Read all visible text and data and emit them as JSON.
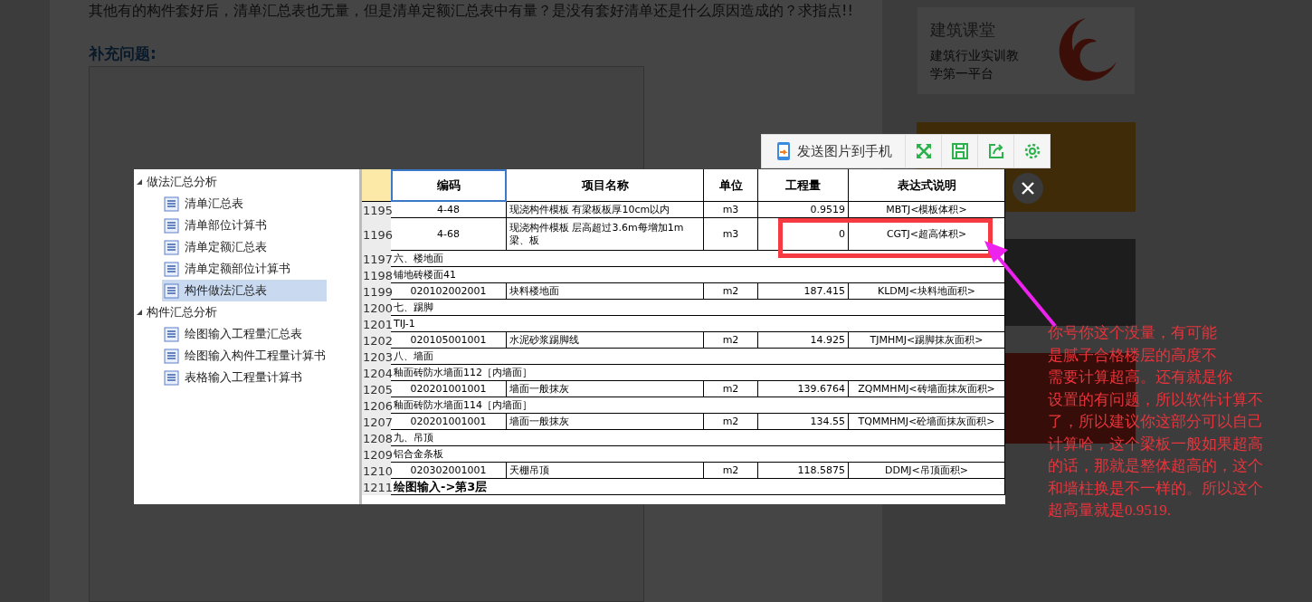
{
  "page": {
    "question": "其他有的构件套好后，清单汇总表也无量，但是清单定额汇总表中有量？是没有套好清单还是什么原因造成的？求指点!!",
    "supplement_heading": "补充问题:"
  },
  "sidebar": {
    "card": {
      "title": "建筑课堂",
      "subtitle": "建筑行业实训教学第一平台"
    }
  },
  "viewer": {
    "toolbar": {
      "send_button": "发送图片到手机"
    },
    "tree": [
      {
        "label": "做法汇总分析",
        "expanded": true,
        "children": [
          {
            "label": "清单汇总表",
            "selected": false
          },
          {
            "label": "清单部位计算书",
            "selected": false
          },
          {
            "label": "清单定额汇总表",
            "selected": false
          },
          {
            "label": "清单定额部位计算书",
            "selected": false
          },
          {
            "label": "构件做法汇总表",
            "selected": true
          }
        ]
      },
      {
        "label": "构件汇总分析",
        "expanded": true,
        "children": [
          {
            "label": "绘图输入工程量汇总表",
            "selected": false
          },
          {
            "label": "绘图输入构件工程量计算书",
            "selected": false
          },
          {
            "label": "表格输入工程量计算书",
            "selected": false
          }
        ]
      }
    ],
    "table": {
      "columns": [
        {
          "label": "编码",
          "selected": true
        },
        {
          "label": "项目名称",
          "selected": false
        },
        {
          "label": "单位",
          "selected": false
        },
        {
          "label": "工程量",
          "selected": false
        },
        {
          "label": "表达式说明",
          "selected": false
        }
      ],
      "rows": [
        {
          "kind": "item",
          "number": "1195",
          "code": "4-48",
          "name": "现浇构件模板 有梁板板厚10cm以内",
          "unit": "m3",
          "quantity": "0.9519",
          "expression": "MBTJ<模板体积>"
        },
        {
          "kind": "item",
          "number": "1196",
          "code": "4-68",
          "name": "现浇构件模板 层高超过3.6m每增加1m梁、板",
          "unit": "m3",
          "quantity": "0",
          "expression": "CGTJ<超高体积>"
        },
        {
          "kind": "section",
          "number": "1197",
          "text": "六、楼地面"
        },
        {
          "kind": "section",
          "number": "1198",
          "text": "铺地砖楼面41"
        },
        {
          "kind": "item",
          "number": "1199",
          "code": "020102002001",
          "name": "块料楼地面",
          "unit": "m2",
          "quantity": "187.415",
          "expression": "KLDMJ<块料地面积>"
        },
        {
          "kind": "section",
          "number": "1200",
          "text": "七、踢脚"
        },
        {
          "kind": "section",
          "number": "1201",
          "text": "TIJ-1"
        },
        {
          "kind": "item",
          "number": "1202",
          "code": "020105001001",
          "name": "水泥砂浆踢脚线",
          "unit": "m2",
          "quantity": "14.925",
          "expression": "TJMHMJ<踢脚抹灰面积>"
        },
        {
          "kind": "section",
          "number": "1203",
          "text": "八、墙面"
        },
        {
          "kind": "section",
          "number": "1204",
          "text": "釉面砖防水墙面112［内墙面］"
        },
        {
          "kind": "item",
          "number": "1205",
          "code": "020201001001",
          "name": "墙面一般抹灰",
          "unit": "m2",
          "quantity": "139.6764",
          "expression": "ZQMMHMJ<砖墙面抹灰面积>"
        },
        {
          "kind": "section",
          "number": "1206",
          "text": "釉面砖防水墙面114［内墙面］"
        },
        {
          "kind": "item",
          "number": "1207",
          "code": "020201001001",
          "name": "墙面一般抹灰",
          "unit": "m2",
          "quantity": "134.55",
          "expression": "TQMMHMJ<砼墙面抹灰面积>"
        },
        {
          "kind": "section",
          "number": "1208",
          "text": "九、吊顶"
        },
        {
          "kind": "section",
          "number": "1209",
          "text": "铝合金条板"
        },
        {
          "kind": "item",
          "number": "1210",
          "code": "020302001001",
          "name": "天棚吊顶",
          "unit": "m2",
          "quantity": "118.5875",
          "expression": "DDMJ<吊顶面积>"
        },
        {
          "kind": "heading",
          "number": "1211",
          "text": "绘图输入->第3层"
        }
      ]
    }
  },
  "annotation": {
    "lines": [
      "你号你这个没量，有可能",
      "是腻子合格楼层的高度不",
      "需要计算超高。还有就是你",
      "设置的有问题，所以软件计算不",
      "了，所以建议你这部分可以自己",
      "计算哈，这个梁板一般如果超高",
      "的话，那就是整体超高的，这个",
      "和墙柱换是不一样的。所以这个",
      "超高量就是0.9519."
    ]
  }
}
